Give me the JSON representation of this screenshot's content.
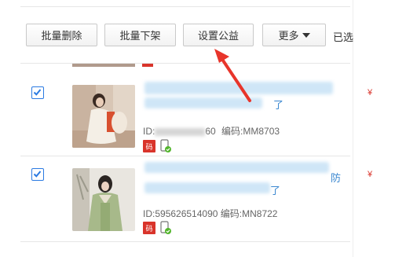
{
  "toolbar": {
    "batch_delete": "批量删除",
    "batch_delist": "批量下架",
    "set_charity": "设置公益",
    "more": "更多",
    "selected_text": "已选"
  },
  "products": [
    {
      "title_visible": "了",
      "id_label": "ID:",
      "id_suffix": "60",
      "code_label": "编码:",
      "code": "MM8703",
      "code_badge": "码",
      "edge_mark": "¥",
      "checked": true
    },
    {
      "title_visible_1": "防",
      "title_visible_2": "了",
      "id_label": "ID:",
      "id": "595626514090",
      "code_label": "编码:",
      "code": "MN8722",
      "code_badge": "码",
      "edge_mark": "¥",
      "checked": true
    }
  ],
  "colors": {
    "accent_blue": "#2a7ae2",
    "link_blue": "#3a87d0",
    "badge_red": "#d9342b",
    "arrow_red": "#e8352b"
  }
}
